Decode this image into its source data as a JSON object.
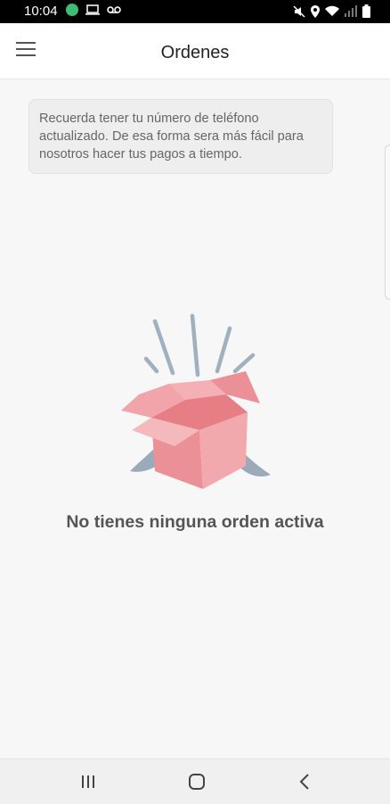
{
  "status_bar": {
    "time": "10:04",
    "icons_left": [
      "chat-bubble-icon",
      "laptop-icon",
      "voicemail-icon"
    ],
    "icons_right": [
      "mute-icon",
      "location-icon",
      "wifi-icon",
      "signal-icon",
      "battery-icon"
    ]
  },
  "app_bar": {
    "title": "Ordenes",
    "menu_icon": "hamburger-menu-icon"
  },
  "notice": {
    "text": "Recuerda tener tu número de teléfono actualizado. De esa forma sera más fácil para nosotros hacer tus pagos a tiempo."
  },
  "empty_state": {
    "message": "No tienes ninguna orden activa",
    "illustration": "open-box-icon"
  },
  "nav_bar": {
    "buttons": [
      "recent-apps-icon",
      "home-icon",
      "back-icon"
    ]
  },
  "colors": {
    "accent_box": "#ea9096",
    "box_light": "#f4b0b4",
    "tentacle": "#9aaab8",
    "ray": "#9fb0bf"
  }
}
